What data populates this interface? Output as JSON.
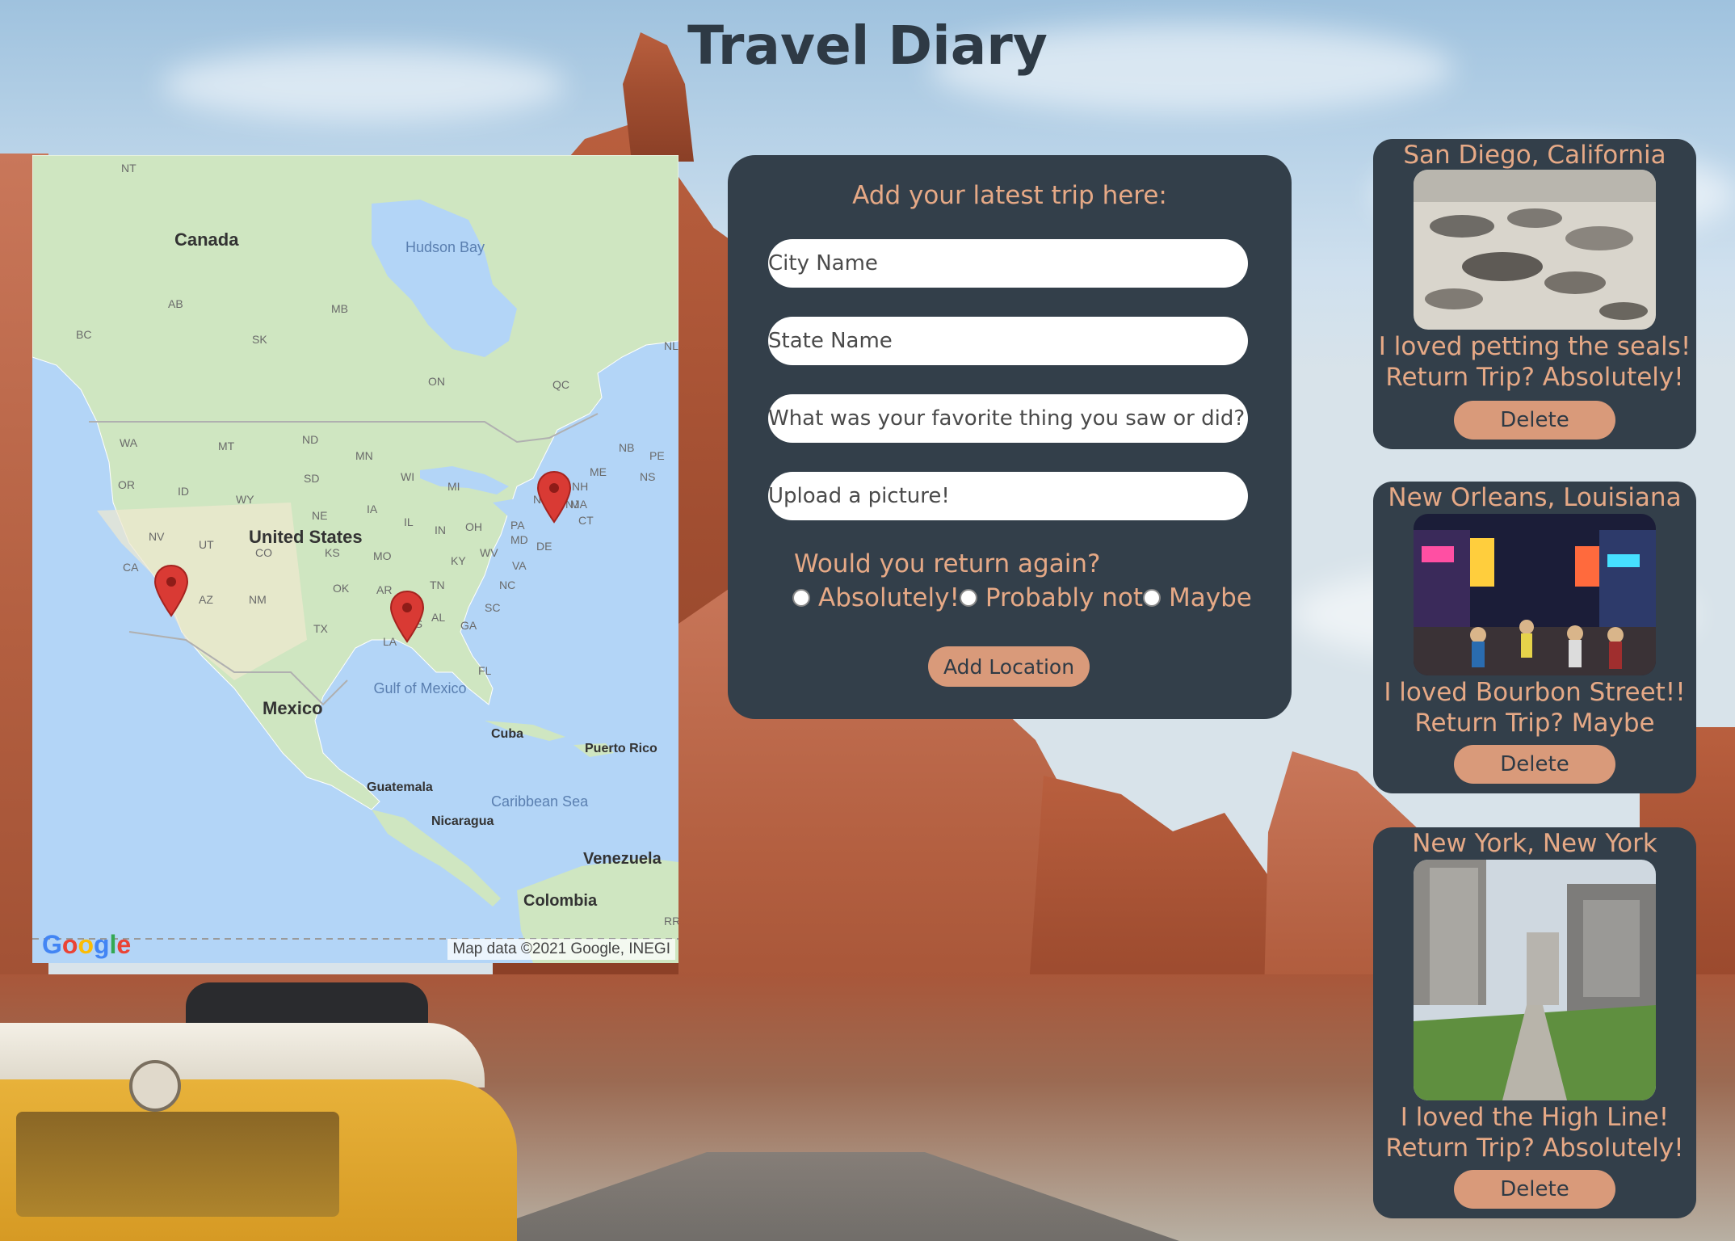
{
  "page": {
    "title": "Travel Diary"
  },
  "map": {
    "attribution": "Map data ©2021 Google, INEGI",
    "logo_text": "Google",
    "labels": {
      "canada": "Canada",
      "united_states": "United States",
      "mexico": "Mexico",
      "hudson_bay": "Hudson Bay",
      "gulf_of_mexico": "Gulf of Mexico",
      "caribbean_sea": "Caribbean Sea",
      "cuba": "Cuba",
      "puerto_rico": "Puerto Rico",
      "guatemala": "Guatemala",
      "nicaragua": "Nicaragua",
      "venezuela": "Venezuela",
      "colombia": "Colombia",
      "nt": "NT",
      "ab": "AB",
      "bc": "BC",
      "sk": "SK",
      "mb": "MB",
      "on": "ON",
      "qc": "QC",
      "nl": "NL",
      "nb": "NB",
      "pe": "PE",
      "ns": "NS",
      "wa": "WA",
      "mt": "MT",
      "nd": "ND",
      "mn": "MN",
      "or": "OR",
      "id": "ID",
      "sd": "SD",
      "wy": "WY",
      "wi": "WI",
      "mi": "MI",
      "ne": "NE",
      "ia": "IA",
      "nv": "NV",
      "ut": "UT",
      "co": "CO",
      "ks": "KS",
      "il": "IL",
      "in": "IN",
      "oh": "OH",
      "pa": "PA",
      "ny": "NY",
      "ca": "CA",
      "az": "AZ",
      "nm": "NM",
      "ok": "OK",
      "mo": "MO",
      "ky": "KY",
      "wv": "WV",
      "va": "VA",
      "md": "MD",
      "de": "DE",
      "nj": "NJ",
      "ct": "CT",
      "ma": "MA",
      "nh": "NH",
      "me": "ME",
      "tx": "TX",
      "ar": "AR",
      "tn": "TN",
      "nc": "NC",
      "sc": "SC",
      "ms": "MS",
      "al": "AL",
      "ga": "GA",
      "la": "LA",
      "fl": "FL",
      "rr": "RR"
    }
  },
  "form": {
    "heading": "Add your latest trip here:",
    "city_placeholder": "City Name",
    "state_placeholder": "State Name",
    "favorite_placeholder": "What was your favorite thing you saw or did?",
    "picture_placeholder": "Upload a picture!",
    "return_question": "Would you return again?",
    "options": [
      "Absolutely!",
      "Probably not",
      "Maybe"
    ],
    "submit_label": "Add Location"
  },
  "trips": [
    {
      "title": "San Diego, California",
      "favorite": "I loved petting the seals!",
      "return": "Return Trip? Absolutely!",
      "delete_label": "Delete"
    },
    {
      "title": "New Orleans, Louisiana",
      "favorite": "I loved Bourbon Street!!",
      "return": "Return Trip? Maybe",
      "delete_label": "Delete"
    },
    {
      "title": "New York, New York",
      "favorite": "I loved the High Line!",
      "return": "Return Trip? Absolutely!",
      "delete_label": "Delete"
    }
  ],
  "colors": {
    "card_bg": "#333f4a",
    "accent_text": "#e6a986",
    "button_bg": "#d99a7a",
    "title_text": "#2e3a45",
    "marker": "#d93a34"
  }
}
